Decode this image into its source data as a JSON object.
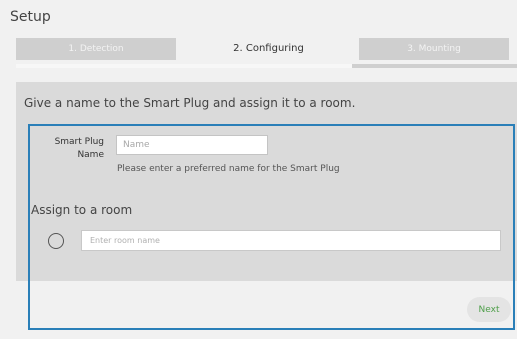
{
  "header": {
    "title": "Setup"
  },
  "steps": [
    {
      "label": "1. Detection",
      "state": "done"
    },
    {
      "label": "2. Configuring",
      "state": "active"
    },
    {
      "label": "3. Mounting",
      "state": "pending"
    }
  ],
  "progress": {
    "fraction": 0.67
  },
  "panel": {
    "instruction": "Give a name to the Smart Plug and assign it to a room."
  },
  "form": {
    "name_label": "Smart Plug Name",
    "name_placeholder": "Name",
    "name_value": "",
    "name_hint": "Please enter a preferred name for the Smart Plug",
    "assign_label": "Assign to a room",
    "room_placeholder": "Enter room name",
    "room_value": ""
  },
  "actions": {
    "next_label": "Next"
  },
  "colors": {
    "highlight": "#2a7fb8",
    "next_text": "#4f9f4a",
    "panel_bg": "#dadada",
    "inactive_step": "#cfcfcf"
  }
}
